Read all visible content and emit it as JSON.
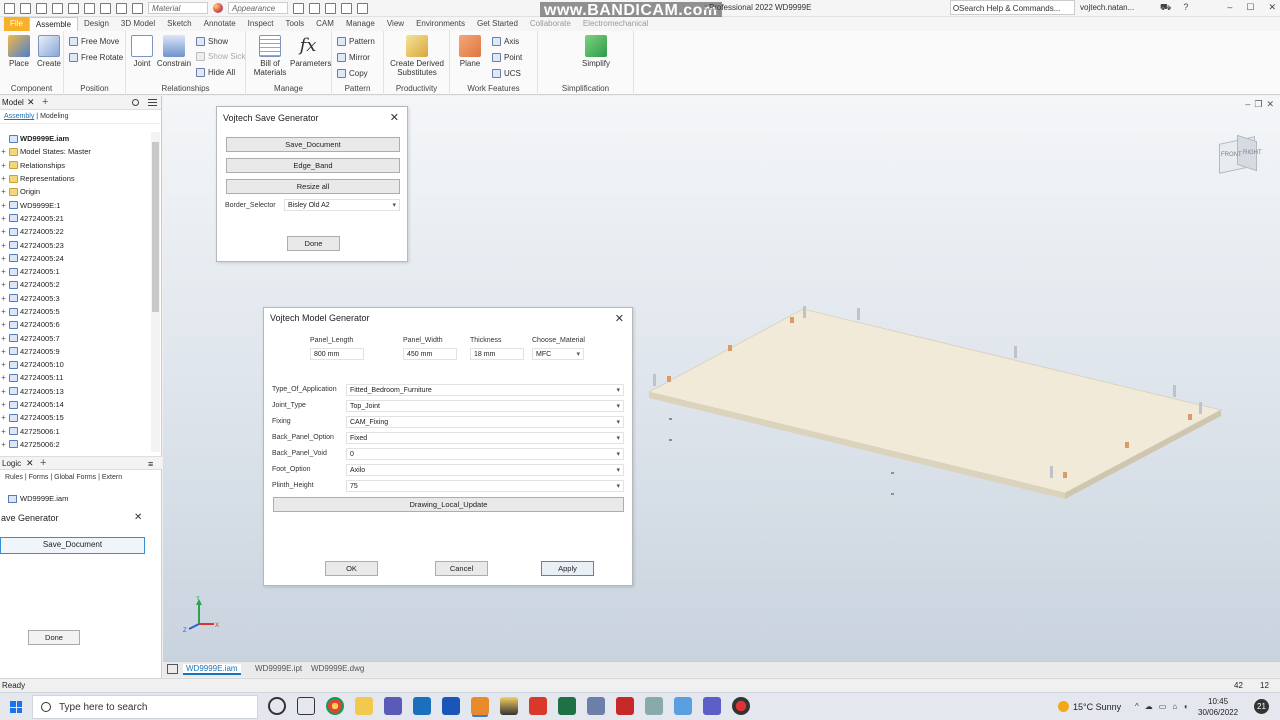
{
  "titlebar": {
    "material": "Material",
    "appearance": "Appearance",
    "watermark": "www.BANDICAM.com",
    "product": "r Professional 2022",
    "file": "WD9999E",
    "help_search": "Search Help & Commands...",
    "user": "vojtech.natan..."
  },
  "tabs": [
    "File",
    "Assemble",
    "Design",
    "3D Model",
    "Sketch",
    "Annotate",
    "Inspect",
    "Tools",
    "CAM",
    "Manage",
    "View",
    "Environments",
    "Get Started",
    "Collaborate",
    "Electromechanical"
  ],
  "active_tab": "Assemble",
  "ribbon": {
    "component": {
      "label": "Component",
      "place": "Place",
      "create": "Create"
    },
    "position": {
      "label": "Position",
      "free_move": "Free Move",
      "free_rotate": "Free Rotate"
    },
    "relationships": {
      "label": "Relationships",
      "joint": "Joint",
      "constrain": "Constrain",
      "show": "Show",
      "show_sick": "Show Sick",
      "hide_all": "Hide All"
    },
    "manage": {
      "label": "Manage",
      "bom": "Bill of\nMaterials",
      "parameters": "Parameters"
    },
    "pattern": {
      "label": "Pattern",
      "pattern": "Pattern",
      "mirror": "Mirror",
      "copy": "Copy"
    },
    "productivity": {
      "label": "Productivity",
      "create_derived": "Create Derived\nSubstitutes"
    },
    "work_features": {
      "label": "Work Features",
      "plane": "Plane",
      "axis": "Axis",
      "point": "Point",
      "ucs": "UCS"
    },
    "simplification": {
      "label": "Simplification",
      "simplify": "Simplify"
    }
  },
  "browser": {
    "title": "Model",
    "subtabs": [
      "Assembly",
      "Modeling"
    ],
    "items": [
      {
        "label": "WD9999E.iam",
        "type": "root"
      },
      {
        "label": "Model States: Master",
        "type": "folder"
      },
      {
        "label": "Relationships",
        "type": "folder"
      },
      {
        "label": "Representations",
        "type": "folder"
      },
      {
        "label": "Origin",
        "type": "folder"
      },
      {
        "label": "WD9999E:1",
        "type": "part"
      },
      {
        "label": "42724005:21",
        "type": "part"
      },
      {
        "label": "42724005:22",
        "type": "part"
      },
      {
        "label": "42724005:23",
        "type": "part"
      },
      {
        "label": "42724005:24",
        "type": "part"
      },
      {
        "label": "42724005:1",
        "type": "part"
      },
      {
        "label": "42724005:2",
        "type": "part"
      },
      {
        "label": "42724005:3",
        "type": "part"
      },
      {
        "label": "42724005:5",
        "type": "part"
      },
      {
        "label": "42724005:6",
        "type": "part"
      },
      {
        "label": "42724005:7",
        "type": "part"
      },
      {
        "label": "42724005:9",
        "type": "part"
      },
      {
        "label": "42724005:10",
        "type": "part"
      },
      {
        "label": "42724005:11",
        "type": "part"
      },
      {
        "label": "42724005:13",
        "type": "part"
      },
      {
        "label": "42724005:14",
        "type": "part"
      },
      {
        "label": "42724005:15",
        "type": "part"
      },
      {
        "label": "42725006:1",
        "type": "part"
      },
      {
        "label": "42725006:2",
        "type": "part"
      }
    ]
  },
  "logic": {
    "title": "Logic",
    "tabs": "Rules  |  Forms  |  Global Forms  |  Extern",
    "file": "WD9999E.iam",
    "save_gen_title": "ave Generator",
    "save_button": "Save_Document",
    "done": "Done"
  },
  "save_dialog": {
    "title": "Vojtech Save Generator",
    "buttons": [
      "Save_Document",
      "Edge_Band",
      "Resize all"
    ],
    "border_label": "Border_Selector",
    "border_value": "Bisley Old A2",
    "done": "Done"
  },
  "model_dialog": {
    "title": "Vojtech Model Generator",
    "top_fields": [
      {
        "label": "Panel_Length",
        "value": "800 mm"
      },
      {
        "label": "Panel_Width",
        "value": "450 mm"
      },
      {
        "label": "Thickness",
        "value": "18 mm"
      },
      {
        "label": "Choose_Material",
        "value": "MFC"
      }
    ],
    "rows": [
      {
        "label": "Type_Of_Application",
        "value": "Fitted_Bedroom_Furniture"
      },
      {
        "label": "Joint_Type",
        "value": "Top_Joint"
      },
      {
        "label": "Fixing",
        "value": "CAM_Fixing"
      },
      {
        "label": "Back_Panel_Option",
        "value": "Fixed"
      },
      {
        "label": "Back_Panel_Void",
        "value": "0"
      },
      {
        "label": "Foot_Option",
        "value": "Axilo"
      },
      {
        "label": "Plinth_Height",
        "value": "75"
      }
    ],
    "update_button": "Drawing_Local_Update",
    "ok": "OK",
    "cancel": "Cancel",
    "apply": "Apply"
  },
  "viewcube": {
    "front": "FRONT",
    "right": "RIGHT"
  },
  "doc_tabs": [
    "WD9999E.iam",
    "WD9999E.ipt",
    "WD9999E.dwg"
  ],
  "status": {
    "text": "Ready",
    "n1": "42",
    "n2": "12"
  },
  "taskbar": {
    "search_placeholder": "Type here to search",
    "weather": "15°C  Sunny",
    "time": "10:45",
    "date": "30/06/2022",
    "notifications": "21",
    "colors": {
      "board_top": "#f1ead8",
      "board_side": "#dcd3bd",
      "accent": "#1a73b8",
      "file_tab": "#f7b128"
    }
  }
}
